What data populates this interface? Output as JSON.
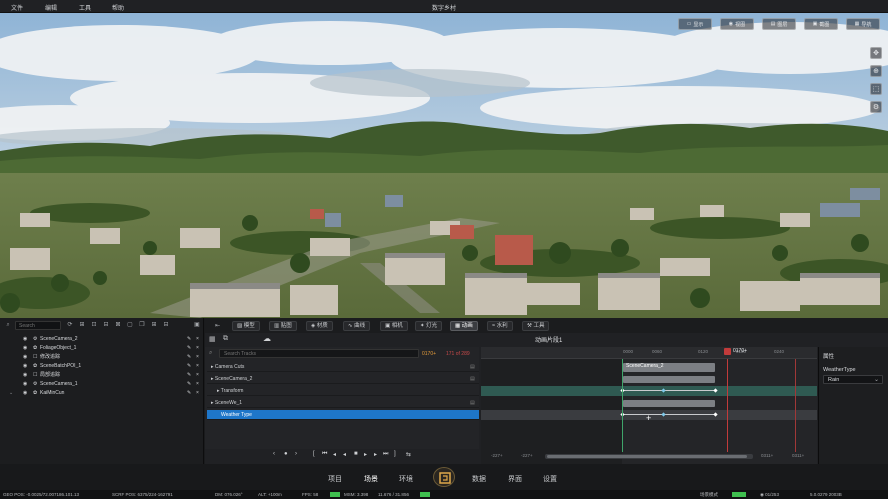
{
  "menu": [
    "文件",
    "编辑",
    "工具",
    "帮助"
  ],
  "app_title": "数字乡村",
  "viewport_buttons": [
    {
      "icon": "screen-icon",
      "label": "显示"
    },
    {
      "icon": "eye-icon",
      "label": "视图"
    },
    {
      "icon": "layers-icon",
      "label": "图层"
    },
    {
      "icon": "image-icon",
      "label": "截图"
    },
    {
      "icon": "grid-icon",
      "label": "导航"
    }
  ],
  "viewport_tools": [
    "✥",
    "⊕",
    "⬚",
    "⚙"
  ],
  "outliner": {
    "search_placeholder": "Search",
    "toolbar_icons": [
      "⟳",
      "⊞",
      "⊡",
      "⊟",
      "⊠",
      "▢",
      "❐",
      "⊞",
      "⊟"
    ],
    "items": [
      {
        "icon": "⚙",
        "label": "SceneCamera_2"
      },
      {
        "icon": "✿",
        "label": "FoliageObject_1"
      },
      {
        "icon": "☐",
        "label": "修改追踪"
      },
      {
        "icon": "✿",
        "label": "SceneBatchPOI_1"
      },
      {
        "icon": "☐",
        "label": "局部追踪"
      },
      {
        "icon": "⚙",
        "label": "SceneCamera_1"
      },
      {
        "icon": "✿",
        "label": "KaiMinCun"
      }
    ]
  },
  "tabs": [
    {
      "icon": "▨",
      "label": "模型"
    },
    {
      "icon": "▥",
      "label": "贴图"
    },
    {
      "icon": "◈",
      "label": "材质"
    },
    {
      "icon": "∿",
      "label": "曲线"
    },
    {
      "icon": "▣",
      "label": "相机"
    },
    {
      "icon": "✦",
      "label": "灯光"
    },
    {
      "icon": "▦",
      "label": "动画"
    },
    {
      "icon": "≈",
      "label": "水利"
    },
    {
      "icon": "⚒",
      "label": "工具"
    }
  ],
  "sequencer": {
    "title": "动画片段1",
    "search_placeholder": "Search Tracks",
    "current_frame": "0170+",
    "frame_range": "171 of 289",
    "tracks": [
      {
        "label": "Camera Cuts",
        "indent": 0
      },
      {
        "label": "▸ SceneCamera_2",
        "indent": 0
      },
      {
        "label": "▸ Transform",
        "indent": 1
      },
      {
        "label": "▸ SceneWe_1",
        "indent": 0
      },
      {
        "label": "Weather Type",
        "indent": 1
      }
    ],
    "transport": [
      "‹",
      "●",
      "›",
      "[",
      "⏮",
      "◂",
      "◂",
      "■",
      "▸",
      "▸",
      "⏭",
      "]",
      "⇆"
    ],
    "ticks": [
      "0000",
      "0060",
      "0120",
      "0180",
      "0240"
    ],
    "segment_label": "SceneCamera_2",
    "range_start": "-227+",
    "range_start2": "-227+",
    "range_end": "0311+",
    "range_end2": "0311+"
  },
  "properties": {
    "header": "属性",
    "field_label": "WeatherType",
    "field_value": "Rain"
  },
  "bottom_nav": [
    "项目",
    "场景",
    "环境",
    "数据",
    "界面",
    "设置"
  ],
  "bottom_nav_active": "场景",
  "status": [
    "GEO POS: -0.0025/72.007186.101.13",
    "SCRF POS: 6375/224-162791",
    "DM: 076.026°",
    "ALT: +100m",
    "FPS: 58",
    "MSM: 3.398",
    "11.676 / 31.856",
    "场景模式",
    "◉ 01/253",
    "5.0.0279 2003B"
  ],
  "colors": {
    "accent": "#1e76c9",
    "playhead": "#c23b3b",
    "keyframe_row": "#2f5a52"
  }
}
